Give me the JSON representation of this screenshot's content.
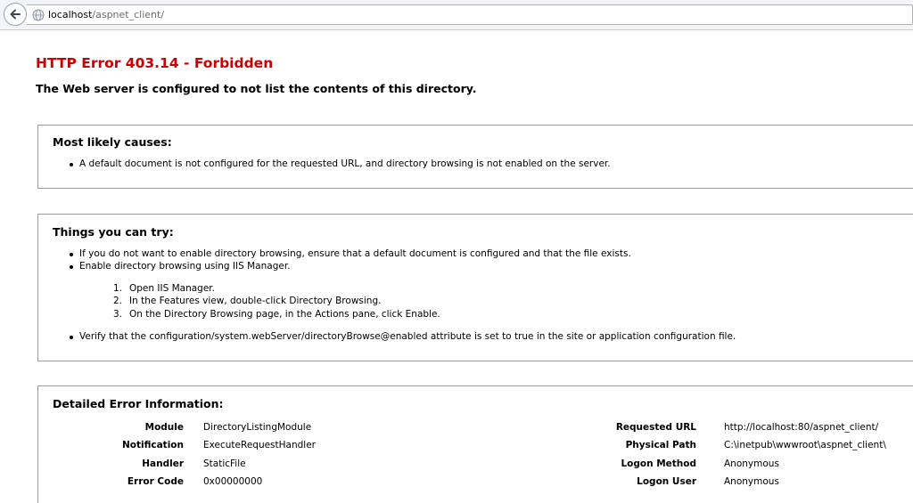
{
  "browser": {
    "url_host": "localhost",
    "url_path": "/aspnet_client/"
  },
  "error": {
    "title": "HTTP Error 403.14 - Forbidden",
    "subtitle": "The Web server is configured to not list the contents of this directory."
  },
  "causes": {
    "heading": "Most likely causes:",
    "items": [
      "A default document is not configured for the requested URL, and directory browsing is not enabled on the server."
    ]
  },
  "try": {
    "heading": "Things you can try:",
    "items": [
      "If you do not want to enable directory browsing, ensure that a default document is configured and that the file exists.",
      "Enable directory browsing using IIS Manager.",
      "Verify that the configuration/system.webServer/directoryBrowse@enabled attribute is set to true in the site or application configuration file."
    ],
    "steps": [
      {
        "num": "1.",
        "text": "Open IIS Manager."
      },
      {
        "num": "2.",
        "text": "In the Features view, double-click Directory Browsing."
      },
      {
        "num": "3.",
        "text": "On the Directory Browsing page, in the Actions pane, click Enable."
      }
    ]
  },
  "details": {
    "heading": "Detailed Error Information:",
    "left": [
      {
        "label": "Module",
        "value": "DirectoryListingModule"
      },
      {
        "label": "Notification",
        "value": "ExecuteRequestHandler"
      },
      {
        "label": "Handler",
        "value": "StaticFile"
      },
      {
        "label": "Error Code",
        "value": "0x00000000"
      }
    ],
    "right": [
      {
        "label": "Requested URL",
        "value": "http://localhost:80/aspnet_client/"
      },
      {
        "label": "Physical Path",
        "value": "C:\\inetpub\\wwwroot\\aspnet_client\\"
      },
      {
        "label": "Logon Method",
        "value": "Anonymous"
      },
      {
        "label": "Logon User",
        "value": "Anonymous"
      }
    ]
  },
  "colors": {
    "error_title": "#cc0000",
    "panel_border": "#9a9a9a"
  }
}
